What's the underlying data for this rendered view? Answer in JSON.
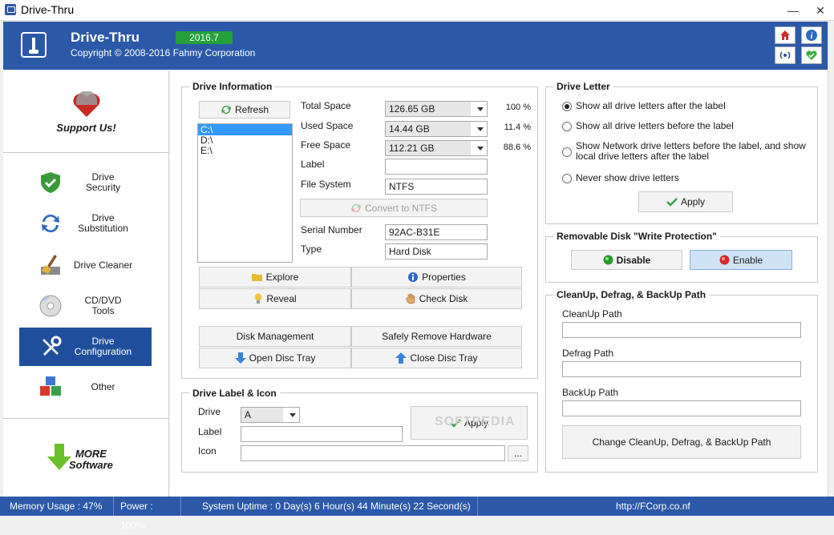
{
  "window": {
    "title": "Drive-Thru",
    "minimize": "—",
    "close": "✕"
  },
  "header": {
    "app_name": "Drive-Thru",
    "copyright": "Copyright © 2008-2016 Fahmy Corporation",
    "version": "2016.7",
    "buttons": [
      "home-icon",
      "info-icon",
      "wireless-icon",
      "heart-icon"
    ]
  },
  "sidebar": {
    "support": "Support Us!",
    "items": [
      {
        "label": "Drive\nSecurity",
        "icon": "shield-check-icon"
      },
      {
        "label": "Drive\nSubstitution",
        "icon": "swap-arrows-icon"
      },
      {
        "label": "Drive Cleaner",
        "icon": "broom-icon"
      },
      {
        "label": "CD/DVD\nTools",
        "icon": "disc-icon"
      },
      {
        "label": "Drive\nConfiguration",
        "icon": "tools-icon",
        "active": true
      },
      {
        "label": "Other",
        "icon": "cubes-icon"
      }
    ],
    "more": "MORE\nSoftware"
  },
  "drive_info": {
    "title": "Drive Information",
    "refresh": "Refresh",
    "drives": [
      "C:\\",
      "D:\\",
      "E:\\"
    ],
    "selected_drive": "C:\\",
    "total_space_label": "Total Space",
    "total_space": "126.65 GB",
    "total_pct": "100 %",
    "used_space_label": "Used Space",
    "used_space": "14.44 GB",
    "used_pct": "11.4 %",
    "free_space_label": "Free Space",
    "free_space": "112.21 GB",
    "free_pct": "88.6 %",
    "label_label": "Label",
    "label_value": "",
    "file_system_label": "File System",
    "file_system": "NTFS",
    "convert": "Convert to NTFS",
    "serial_label": "Serial Number",
    "serial": "92AC-B31E",
    "type_label": "Type",
    "type": "Hard Disk",
    "explore": "Explore",
    "properties": "Properties",
    "reveal": "Reveal",
    "check_disk": "Check Disk",
    "disk_management": "Disk Management",
    "safely_remove": "Safely Remove Hardware",
    "open_tray": "Open Disc Tray",
    "close_tray": "Close Disc Tray"
  },
  "drive_label_icon": {
    "title": "Drive Label & Icon",
    "drive_label": "Drive",
    "drive_value": "A",
    "label_label": "Label",
    "label_value": "",
    "icon_label": "Icon",
    "icon_value": "",
    "browse": "...",
    "apply": "Apply"
  },
  "drive_letter": {
    "title": "Drive Letter",
    "options": [
      "Show all drive letters after the label",
      "Show all drive letters before the label",
      "Show Network drive letters before the label, and show local drive letters after the label",
      "Never show drive letters"
    ],
    "selected_index": 0,
    "apply": "Apply"
  },
  "write_protection": {
    "title": "Removable Disk \"Write Protection\"",
    "disable": "Disable",
    "enable": "Enable"
  },
  "paths": {
    "title": "CleanUp, Defrag, & BackUp Path",
    "cleanup_label": "CleanUp Path",
    "cleanup_value": "",
    "defrag_label": "Defrag Path",
    "defrag_value": "",
    "backup_label": "BackUp Path",
    "backup_value": "",
    "change": "Change CleanUp, Defrag, & BackUp Path"
  },
  "watermark": "SOFTPEDIA",
  "status": {
    "memory": "Memory Usage : 47%",
    "power": "Power : 100%",
    "uptime": "System Uptime : 0 Day(s) 6 Hour(s) 44 Minute(s) 22 Second(s)",
    "url": "http://FCorp.co.nf"
  },
  "colors": {
    "header": "#2c58a8",
    "active_nav": "#1f4f9c",
    "version_badge": "#23a03a"
  }
}
